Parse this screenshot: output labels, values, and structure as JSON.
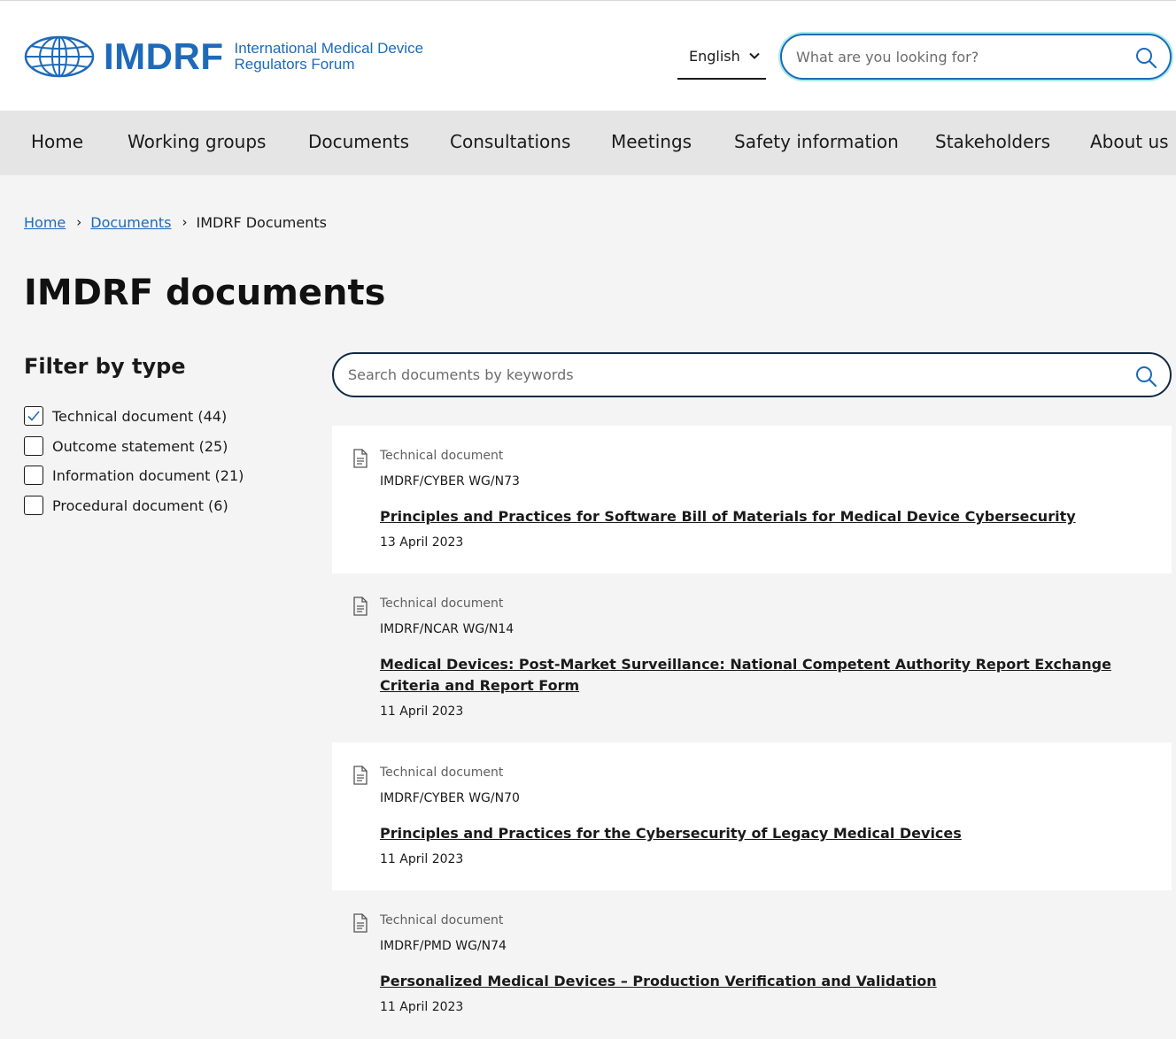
{
  "brand": {
    "wordmark": "IMDRF",
    "tagline_line1": "International Medical Device",
    "tagline_line2": "Regulators Forum",
    "color": "#1e6ab8"
  },
  "language": {
    "selected": "English",
    "icon": "chevron-down-icon"
  },
  "site_search": {
    "placeholder": "What are you looking for?",
    "icon": "search-icon"
  },
  "nav": {
    "items": [
      "Home",
      "Working groups",
      "Documents",
      "Consultations",
      "Meetings",
      "Safety information",
      "Stakeholders",
      "About us"
    ]
  },
  "breadcrumb": {
    "items": [
      "Home",
      "Documents"
    ],
    "current": "IMDRF Documents"
  },
  "page": {
    "title": "IMDRF documents"
  },
  "filters": {
    "title": "Filter by type",
    "options": [
      {
        "label": "Technical document (44)",
        "checked": true
      },
      {
        "label": "Outcome statement (25)",
        "checked": false
      },
      {
        "label": "Information document (21)",
        "checked": false
      },
      {
        "label": "Procedural document (6)",
        "checked": false
      }
    ]
  },
  "doc_search": {
    "placeholder": "Search documents by keywords",
    "icon": "search-icon"
  },
  "documents": [
    {
      "type": "Technical document",
      "ref": "IMDRF/CYBER WG/N73",
      "title": "Principles and Practices for Software Bill of Materials for Medical Device Cybersecurity",
      "date": "13 April 2023"
    },
    {
      "type": "Technical document",
      "ref": "IMDRF/NCAR WG/N14",
      "title": "Medical Devices: Post-Market Surveillance: National Competent Authority Report Exchange Criteria and Report Form",
      "date": "11 April 2023"
    },
    {
      "type": "Technical document",
      "ref": "IMDRF/CYBER WG/N70",
      "title": "Principles and Practices for the Cybersecurity of Legacy Medical Devices",
      "date": "11 April 2023"
    },
    {
      "type": "Technical document",
      "ref": "IMDRF/PMD WG/N74",
      "title": "Personalized Medical Devices – Production Verification and Validation",
      "date": "11 April 2023"
    }
  ],
  "colors": {
    "link": "#1e6ab8",
    "search_glow": "#a6ece6",
    "nav_bg": "#e5e5e5",
    "page_bg": "#f4f4f4"
  }
}
